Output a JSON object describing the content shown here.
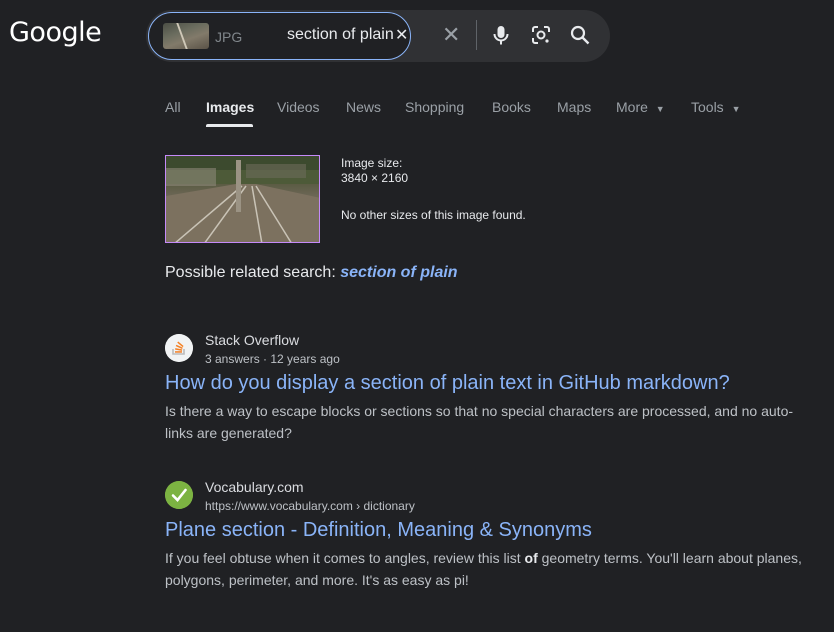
{
  "logo": "Google",
  "search": {
    "chip_label": "JPG",
    "query": "section of plain"
  },
  "tabs": [
    {
      "label": "All",
      "active": false
    },
    {
      "label": "Images",
      "active": true
    },
    {
      "label": "Videos",
      "active": false
    },
    {
      "label": "News",
      "active": false
    },
    {
      "label": "Shopping",
      "active": false
    },
    {
      "label": "Books",
      "active": false
    },
    {
      "label": "Maps",
      "active": false
    },
    {
      "label": "More",
      "active": false
    },
    {
      "label": "Tools",
      "active": false
    }
  ],
  "image_info": {
    "size_label": "Image size:",
    "size_value": "3840 × 2160",
    "other_sizes": "No other sizes of this image found."
  },
  "related": {
    "prefix": "Possible related search:",
    "query": "section of plain"
  },
  "results": [
    {
      "site": "Stack Overflow",
      "meta": "3 answers · 12 years ago",
      "title": "How do you display a section of plain text in GitHub markdown?",
      "snippet": "Is there a way to escape blocks or sections so that no special characters are processed, and no auto-links are generated?"
    },
    {
      "site": "Vocabulary.com",
      "meta": "https://www.vocabulary.com › dictionary",
      "title": "Plane section - Definition, Meaning & Synonyms",
      "snippet_a": "If you feel obtuse when it comes to angles, review this list ",
      "snippet_b": "of",
      "snippet_c": " geometry terms. You'll learn about planes, polygons, perimeter, and more. It's as easy as pi!"
    }
  ],
  "colors": {
    "background": "#202124",
    "link": "#8ab4f8",
    "text": "#bdc1c6"
  }
}
